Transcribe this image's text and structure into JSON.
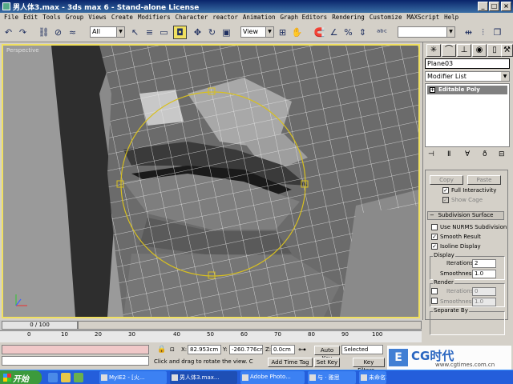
{
  "window": {
    "title": "男人体3.max - 3ds max 6 - Stand-alone License"
  },
  "menu": [
    "File",
    "Edit",
    "Tools",
    "Group",
    "Views",
    "Create",
    "Modifiers",
    "Character",
    "reactor",
    "Animation",
    "Graph Editors",
    "Rendering",
    "Customize",
    "MAXScript",
    "Help"
  ],
  "toolbar": {
    "selection_filter": "All",
    "ref_coord": "View",
    "named_sel": ""
  },
  "viewport": {
    "label": "Perspective",
    "frame_color": "#f0e060",
    "mesh_color": "#5a5a5a",
    "wire_color": "#e8e8e8"
  },
  "command_panel": {
    "object_name": "Plane03",
    "modifier_list": "Modifier List",
    "stack_item": "Editable Poly",
    "copy_label": "Copy",
    "paste_label": "Paste",
    "full_interactivity": "Full Interactivity",
    "show_cage": "Show Cage",
    "subdivision_title": "Subdivision Surface",
    "use_nurms": "Use NURMS Subdivision",
    "smooth_result": "Smooth Result",
    "isoline_display": "Isoline Display",
    "display_group": "Display",
    "iterations_label": "Iterations:",
    "iterations_value": "2",
    "smoothness_label": "Smoothness:",
    "smoothness_value": "1.0",
    "render_group": "Render",
    "render_iterations_value": "0",
    "render_smoothness_value": "1.0",
    "separate_group": "Separate By",
    "smoothing_groups": "Smoothing Groups",
    "materials": "Materials",
    "update_options": "Update Options"
  },
  "timeline": {
    "slider": "0 / 100",
    "ticks": [
      "0",
      "10",
      "20",
      "30",
      "40",
      "50",
      "60",
      "70",
      "80",
      "90",
      "100"
    ]
  },
  "status": {
    "prompt": "Click and drag to rotate the view. C",
    "x_label": "X:",
    "x_value": "82.953cm",
    "y_label": "Y:",
    "y_value": "-260.776cr",
    "z_label": "Z:",
    "z_value": "0.0cm",
    "auto_key": "Auto Key",
    "set_key": "Set Key",
    "selected": "Selected",
    "key_filters": "Key Filters...",
    "add_time_tag": "Add Time Tag"
  },
  "taskbar": {
    "start": "开始",
    "tasks": [
      "MyIE2 - [火...",
      "男人体3.max...",
      "Adobe Photo...",
      "与 · 雅思",
      "未命名3 - 画图"
    ],
    "watermark": "CG时代",
    "watermark_url": "www.cgtimes.com.cn"
  }
}
